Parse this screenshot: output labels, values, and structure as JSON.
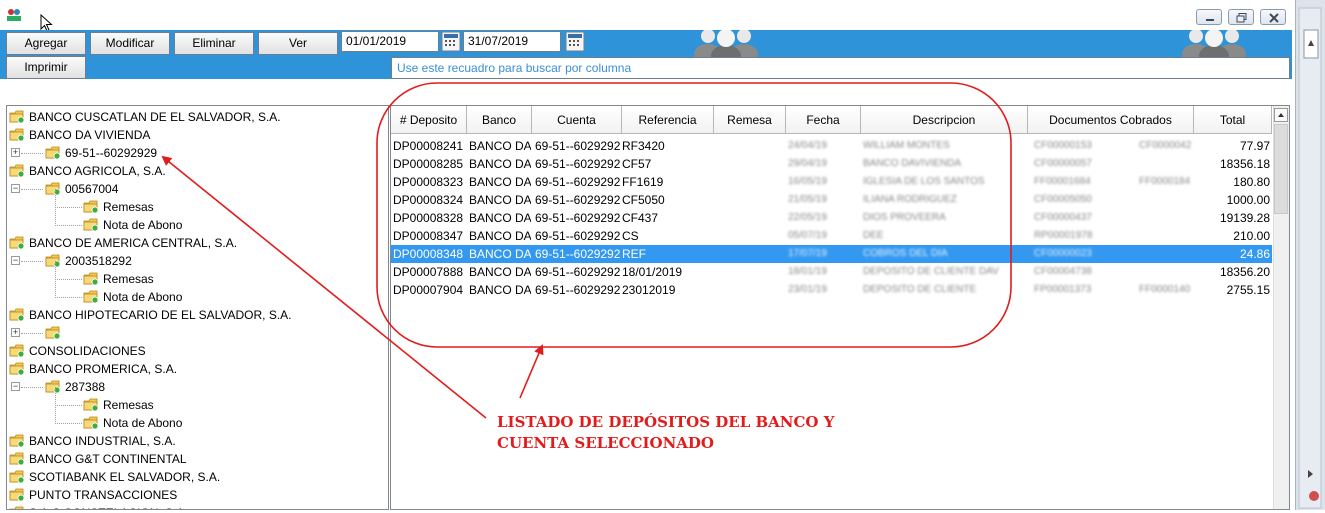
{
  "toolbar": {
    "agregar": "Agregar",
    "modificar": "Modificar",
    "eliminar": "Eliminar",
    "ver": "Ver",
    "imprimir": "Imprimir",
    "date_from": "01/01/2019",
    "date_to": "31/07/2019",
    "search_hint": "Use este recuadro para buscar por columna"
  },
  "tree": [
    {
      "label": "BANCO CUSCATLAN DE EL SALVADOR, S.A.",
      "level": 0
    },
    {
      "label": "BANCO DA VIVIENDA",
      "level": 0
    },
    {
      "label": "69-51--60292929",
      "level": 1,
      "expander": "+"
    },
    {
      "label": "BANCO AGRICOLA, S.A.",
      "level": 0
    },
    {
      "label": "00567004",
      "level": 1,
      "expander": "−"
    },
    {
      "label": "Remesas",
      "level": 2
    },
    {
      "label": "Nota de Abono",
      "level": 2
    },
    {
      "label": "BANCO DE AMERICA CENTRAL, S.A.",
      "level": 0
    },
    {
      "label": "2003518292",
      "level": 1,
      "expander": "−"
    },
    {
      "label": "Remesas",
      "level": 2
    },
    {
      "label": "Nota de Abono",
      "level": 2
    },
    {
      "label": "BANCO HIPOTECARIO DE EL SALVADOR, S.A.",
      "level": 0
    },
    {
      "label": "",
      "level": 1,
      "expander": "+"
    },
    {
      "label": "CONSOLIDACIONES",
      "level": 0
    },
    {
      "label": "BANCO PROMERICA, S.A.",
      "level": 0
    },
    {
      "label": "287388",
      "level": 1,
      "expander": "−"
    },
    {
      "label": "Remesas",
      "level": 2
    },
    {
      "label": "Nota de Abono",
      "level": 2
    },
    {
      "label": "BANCO INDUSTRIAL, S.A.",
      "level": 0
    },
    {
      "label": "BANCO G&T CONTINENTAL",
      "level": 0
    },
    {
      "label": "SCOTIABANK EL SALVADOR, S.A.",
      "level": 0
    },
    {
      "label": "PUNTO TRANSACCIONES",
      "level": 0
    },
    {
      "label": "S.A.C CONSTELACION, S.A.",
      "level": 0
    }
  ],
  "grid": {
    "columns": [
      "# Deposito",
      "Banco",
      "Cuenta",
      "Referencia",
      "Remesa",
      "Fecha",
      "Descripcion",
      "Documentos Cobrados",
      "Total"
    ],
    "rows": [
      {
        "deposito": "DP00008241",
        "banco": "BANCO DA",
        "cuenta": "69-51--6029292",
        "referencia": "RF3420",
        "remesa": "",
        "fecha": "24/04/19",
        "descripcion": "WILLIAM MONTES",
        "docs1": "CF00000153",
        "docs2": "CF0000042",
        "total": "77.97",
        "selected": false
      },
      {
        "deposito": "DP00008285",
        "banco": "BANCO DA",
        "cuenta": "69-51--6029292",
        "referencia": "CF57",
        "remesa": "",
        "fecha": "29/04/19",
        "descripcion": "BANCO DAVIVIENDA",
        "docs1": "CF00000057",
        "docs2": "",
        "total": "18356.18",
        "selected": false
      },
      {
        "deposito": "DP00008323",
        "banco": "BANCO DA",
        "cuenta": "69-51--6029292",
        "referencia": "FF1619",
        "remesa": "",
        "fecha": "16/05/19",
        "descripcion": "IGLESIA DE LOS SANTOS",
        "docs1": "FF00001684",
        "docs2": "FF0000184",
        "total": "180.80",
        "selected": false
      },
      {
        "deposito": "DP00008324",
        "banco": "BANCO DA",
        "cuenta": "69-51--6029292",
        "referencia": "CF5050",
        "remesa": "",
        "fecha": "21/05/19",
        "descripcion": "ILIANA RODRIGUEZ",
        "docs1": "CF00005050",
        "docs2": "",
        "total": "1000.00",
        "selected": false
      },
      {
        "deposito": "DP00008328",
        "banco": "BANCO DA",
        "cuenta": "69-51--6029292",
        "referencia": "CF437",
        "remesa": "",
        "fecha": "22/05/19",
        "descripcion": "DIOS PROVEERA",
        "docs1": "CF00000437",
        "docs2": "",
        "total": "19139.28",
        "selected": false
      },
      {
        "deposito": "DP00008347",
        "banco": "BANCO DA",
        "cuenta": "69-51--6029292",
        "referencia": "CS",
        "remesa": "",
        "fecha": "05/07/19",
        "descripcion": "DEE",
        "docs1": "RP00001978",
        "docs2": "",
        "total": "210.00",
        "selected": false
      },
      {
        "deposito": "DP00008348",
        "banco": "BANCO DA",
        "cuenta": "69-51--6029292",
        "referencia": "REF",
        "remesa": "",
        "fecha": "17/07/19",
        "descripcion": "COBROS DEL DIA",
        "docs1": "CF00000023",
        "docs2": "",
        "total": "24.86",
        "selected": true
      },
      {
        "deposito": "DP00007888",
        "banco": "BANCO DA",
        "cuenta": "69-51--6029292",
        "referencia": "18/01/2019",
        "remesa": "",
        "fecha": "18/01/19",
        "descripcion": "DEPOSITO DE CLIENTE DAV",
        "docs1": "CF00004738",
        "docs2": "",
        "total": "18356.20",
        "selected": false
      },
      {
        "deposito": "DP00007904",
        "banco": "BANCO DA",
        "cuenta": "69-51--6029292",
        "referencia": "23012019",
        "remesa": "",
        "fecha": "23/01/19",
        "descripcion": "DEPOSITO DE CLIENTE",
        "docs1": "FP00001373",
        "docs2": "FF0000140",
        "total": "2755.15",
        "selected": false
      }
    ]
  },
  "annotation": {
    "line1": "LISTADO DE DEPÓSITOS DEL BANCO Y",
    "line2": "CUENTA SELECCIONADO",
    "color": "#e21c1c"
  },
  "colors": {
    "toolbar": "#2f93d9",
    "selection": "#3399f0",
    "folder": "#f5c84c",
    "badge": "#3cae3c"
  },
  "icons": {
    "folder": "folder-icon",
    "calendar": "calendar-icon",
    "people": "people-icon"
  }
}
